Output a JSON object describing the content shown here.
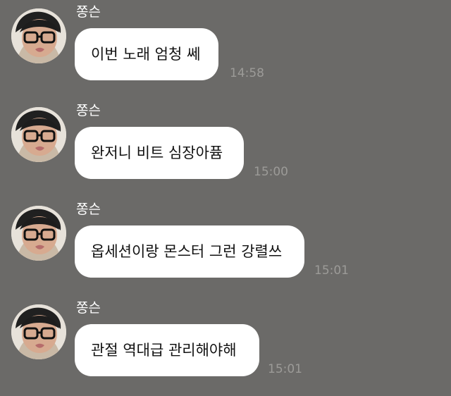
{
  "chat": {
    "messages": [
      {
        "sender": "쫑슨",
        "text": "이번 노래 엄청 쎄",
        "time": "14:58"
      },
      {
        "sender": "쫑슨",
        "text": "완저니 비트 심장아퓸",
        "time": "15:00"
      },
      {
        "sender": "쫑슨",
        "text": "옵세션이랑 몬스터 그런 강렬쓰",
        "time": "15:01"
      },
      {
        "sender": "쫑슨",
        "text": "관절 역대급 관리해야해",
        "time": "15:01"
      }
    ]
  },
  "colors": {
    "background": "#6b6a68",
    "bubble": "#ffffff",
    "sender_text": "#ffffff",
    "time_text": "#9c9b98"
  },
  "icons": {
    "avatar": "profile-photo-avatar"
  }
}
